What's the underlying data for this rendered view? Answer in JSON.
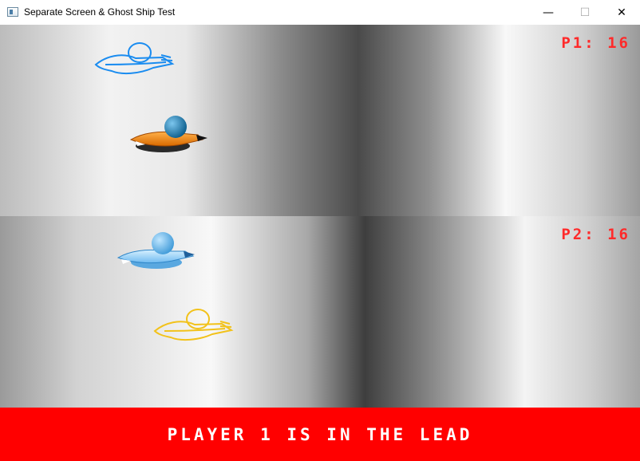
{
  "window": {
    "title": "Separate Screen & Ghost Ship Test",
    "controls": {
      "minimize": "—",
      "maximize": "☐",
      "close": "✕"
    }
  },
  "player1": {
    "label": "P1:",
    "score": "16",
    "ship_color": "#f08a18",
    "ghost_color": "#1a8cf0"
  },
  "player2": {
    "label": "P2:",
    "score": "16",
    "ship_color": "#8fd2ff",
    "ghost_color": "#f2c21a"
  },
  "banner": {
    "message": "PLAYER 1 IS IN THE LEAD",
    "color": "#ff0000"
  },
  "colors": {
    "score_text": "#ff2a2a"
  }
}
